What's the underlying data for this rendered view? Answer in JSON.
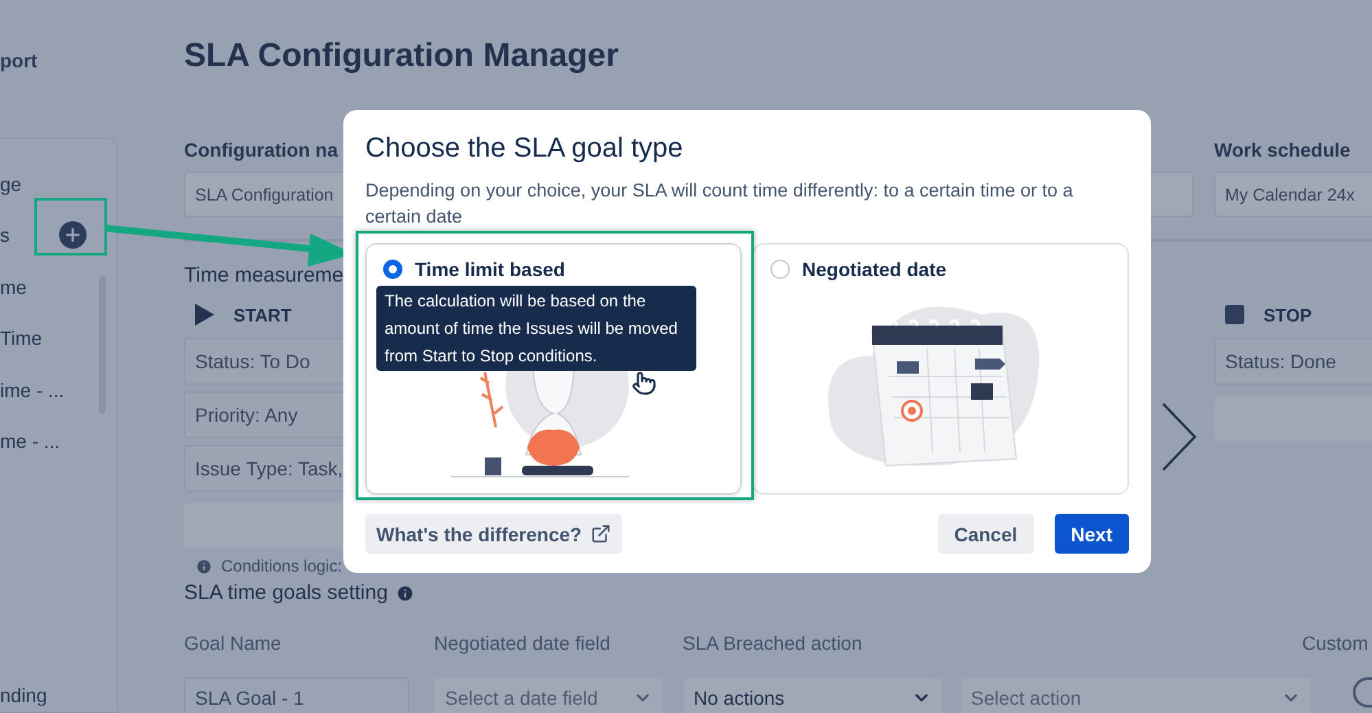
{
  "sidebar": {
    "heading": "port",
    "items": [
      {
        "label": "ge",
        "kind": "plain"
      },
      {
        "label": "s",
        "kind": "add"
      },
      {
        "label": "me",
        "kind": "plain"
      },
      {
        "label": "Time",
        "kind": "plain"
      },
      {
        "label": "ime - ...",
        "kind": "plain"
      },
      {
        "label": "me - ...",
        "kind": "plain"
      }
    ],
    "footer_item": "nding"
  },
  "main": {
    "title": "SLA Configuration Manager",
    "configuration_name": {
      "label": "Configuration na",
      "value": "SLA Configuration"
    },
    "work_schedule": {
      "label": "Work schedule",
      "value": "My Calendar 24x"
    },
    "time_measurement": {
      "title": "Time measureme",
      "start": {
        "label": "START",
        "conditions": [
          "Status: To Do",
          "Priority: Any",
          "Issue Type: Task,"
        ]
      },
      "stop": {
        "label": "STOP",
        "conditions": [
          "Status: Done"
        ]
      },
      "conditions_logic": "Conditions logic:"
    },
    "goals": {
      "title": "SLA time goals setting",
      "columns": [
        "Goal Name",
        "Negotiated date field",
        "SLA Breached action",
        "Custom"
      ],
      "rows": [
        {
          "goal_name": "SLA Goal - 1",
          "date_field": {
            "placeholder": "Select a date field"
          },
          "breached_action": "No actions",
          "action": {
            "placeholder": "Select action"
          },
          "custom_enabled": false
        }
      ]
    }
  },
  "modal": {
    "title": "Choose the SLA goal type",
    "description": "Depending on your choice, your SLA will count time differently: to a certain time or to a certain date",
    "options": [
      {
        "label": "Time limit based",
        "selected": true,
        "kind": "hourglass",
        "tooltip": "The calculation will be based on the amount of time the Issues will be moved from Start to Stop conditions."
      },
      {
        "label": "Negotiated date",
        "selected": false,
        "kind": "calendar"
      }
    ],
    "help_link": "What's the difference?",
    "buttons": [
      {
        "label": "Cancel",
        "kind": "secondary"
      },
      {
        "label": "Next",
        "kind": "primary"
      }
    ]
  }
}
